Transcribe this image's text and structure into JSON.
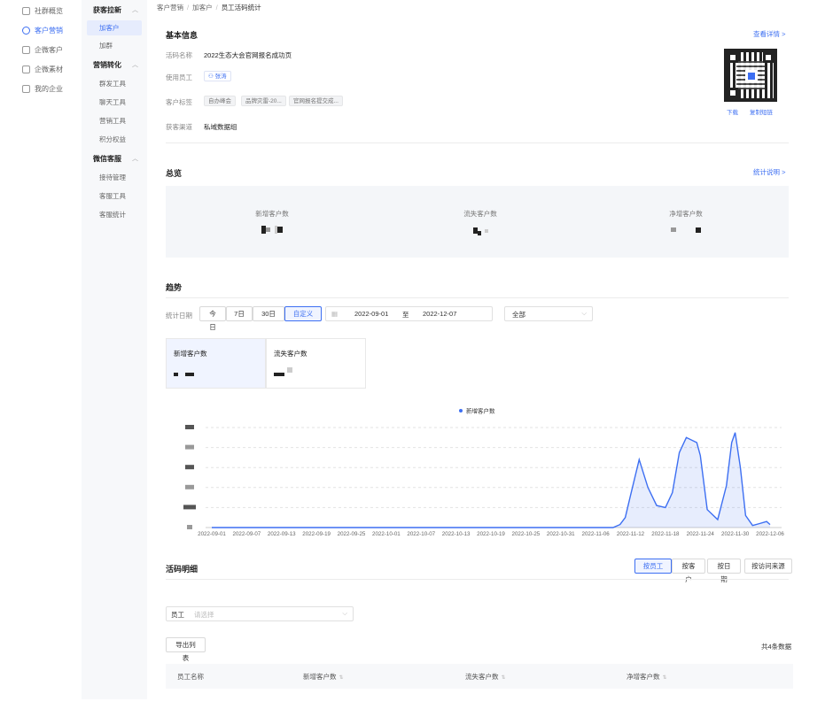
{
  "nav1": [
    {
      "label": "社群概览",
      "icon": "home-icon",
      "active": false
    },
    {
      "label": "客户营销",
      "icon": "user-icon",
      "active": true
    },
    {
      "label": "企微客户",
      "icon": "person-icon",
      "active": false
    },
    {
      "label": "企微素材",
      "icon": "folder-icon",
      "active": false
    },
    {
      "label": "我的企业",
      "icon": "building-icon",
      "active": false
    }
  ],
  "nav2": {
    "group1": "获客拉新",
    "g1_items": [
      "加客户",
      "加群"
    ],
    "group2": "营销转化",
    "g2_items": [
      "群发工具",
      "聊天工具",
      "营销工具",
      "积分权益"
    ],
    "group3": "微信客服",
    "g3_items": [
      "接待管理",
      "客服工具",
      "客服统计"
    ]
  },
  "breadcrumb": {
    "a": "客户营销",
    "b": "加客户",
    "c": "员工活码统计",
    "sep": "/"
  },
  "basic": {
    "title": "基本信息",
    "detail_link": "查看详情 >",
    "name_label": "活码名称",
    "name_value": "2022生态大会官网报名成功页",
    "employee_label": "使用员工",
    "employee_value": "张涛",
    "tag_label": "客户标签",
    "tags": [
      "自办峰会",
      "品牌灾雷-20...",
      "官网报名提交成..."
    ],
    "channel_label": "获客渠道",
    "channel_value": "私域数据组",
    "download": "下载",
    "copy_link": "复制短链"
  },
  "overview": {
    "title": "总览",
    "help_link": "统计说明 >",
    "items": [
      "新增客户数",
      "流失客户数",
      "净增客户数"
    ]
  },
  "trend": {
    "title": "趋势",
    "date_label": "统计日期",
    "ranges": [
      "今日",
      "7日",
      "30日",
      "自定义"
    ],
    "start": "2022-09-01",
    "to": "至",
    "end": "2022-12-07",
    "filter": "全部",
    "kpi1": "新增客户数",
    "kpi2": "流失客户数"
  },
  "chart_data": {
    "type": "line",
    "legend": "新增客户数",
    "x": [
      "2022-09-01",
      "2022-09-07",
      "2022-09-13",
      "2022-09-19",
      "2022-09-25",
      "2022-10-01",
      "2022-10-07",
      "2022-10-13",
      "2022-10-19",
      "2022-10-25",
      "2022-10-31",
      "2022-11-06",
      "2022-11-12",
      "2022-11-18",
      "2022-11-24",
      "2022-11-30",
      "2022-12-06"
    ],
    "values": [
      0,
      0,
      0,
      0,
      0,
      0,
      0,
      0,
      0,
      0,
      0,
      0,
      10,
      12,
      55,
      100,
      2
    ],
    "grid": true,
    "legend_position": "top"
  },
  "detail": {
    "title": "活码明细",
    "tabs": [
      "按员工",
      "按客户",
      "按日期",
      "按访问来源"
    ],
    "emp_label": "员工",
    "emp_placeholder": "请选择",
    "export": "导出列表",
    "total": "共4条数据",
    "cols": [
      "员工名称",
      "新增客户数",
      "流失客户数",
      "净增客户数"
    ]
  }
}
